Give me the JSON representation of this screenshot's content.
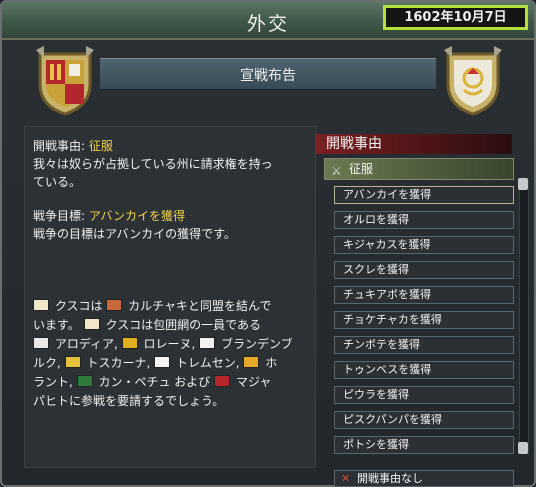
{
  "window": {
    "title": "外交",
    "date": "1602年10月7日"
  },
  "header": {
    "title": "宣戦布告"
  },
  "left": {
    "cb_label": "開戦事由: ",
    "cb_value": "征服",
    "cb_desc_1": "我々は奴らが占拠している州に請求権を持っ",
    "cb_desc_2": "ている。",
    "goal_label": "戦争目標: ",
    "goal_value": "アバンカイを獲得",
    "goal_desc": "戦争の目標はアバンカイの獲得です。",
    "alliance_line1_a": "クスコは",
    "alliance_line1_b": "カルチャキと同盟を結んで",
    "alliance_line2_a": "います。",
    "alliance_line2_b": "クスコは包囲網の一員である",
    "alliance_line3_a": "アロディア,",
    "alliance_line3_b": "ロレーヌ,",
    "alliance_line3_c": "ブランデンブ",
    "alliance_line4_a": "ルク,",
    "alliance_line4_b": "トスカーナ,",
    "alliance_line4_c": "トレムセン,",
    "alliance_line4_d": "ホ",
    "alliance_line5_a": "ラント,",
    "alliance_line5_b": "カン・ペチュ および",
    "alliance_line5_c": "マジャ",
    "alliance_line6": "パヒトに参戦を要請するでしょう。"
  },
  "right": {
    "header": "開戦事由",
    "selected": "征服",
    "items": [
      "アバンカイを獲得",
      "オルロを獲得",
      "キジャカスを獲得",
      "スクレを獲得",
      "チュキアボを獲得",
      "チョケチャカを獲得",
      "チンボテを獲得",
      "トゥンベスを獲得",
      "ピウラを獲得",
      "ピスクパンパを獲得",
      "ポトシを獲得"
    ],
    "none_label": "開戦事由なし"
  },
  "colors": {
    "highlight": "#b6df3d",
    "goal_text": "#f0d24a",
    "cb_header": "#7a2024"
  }
}
